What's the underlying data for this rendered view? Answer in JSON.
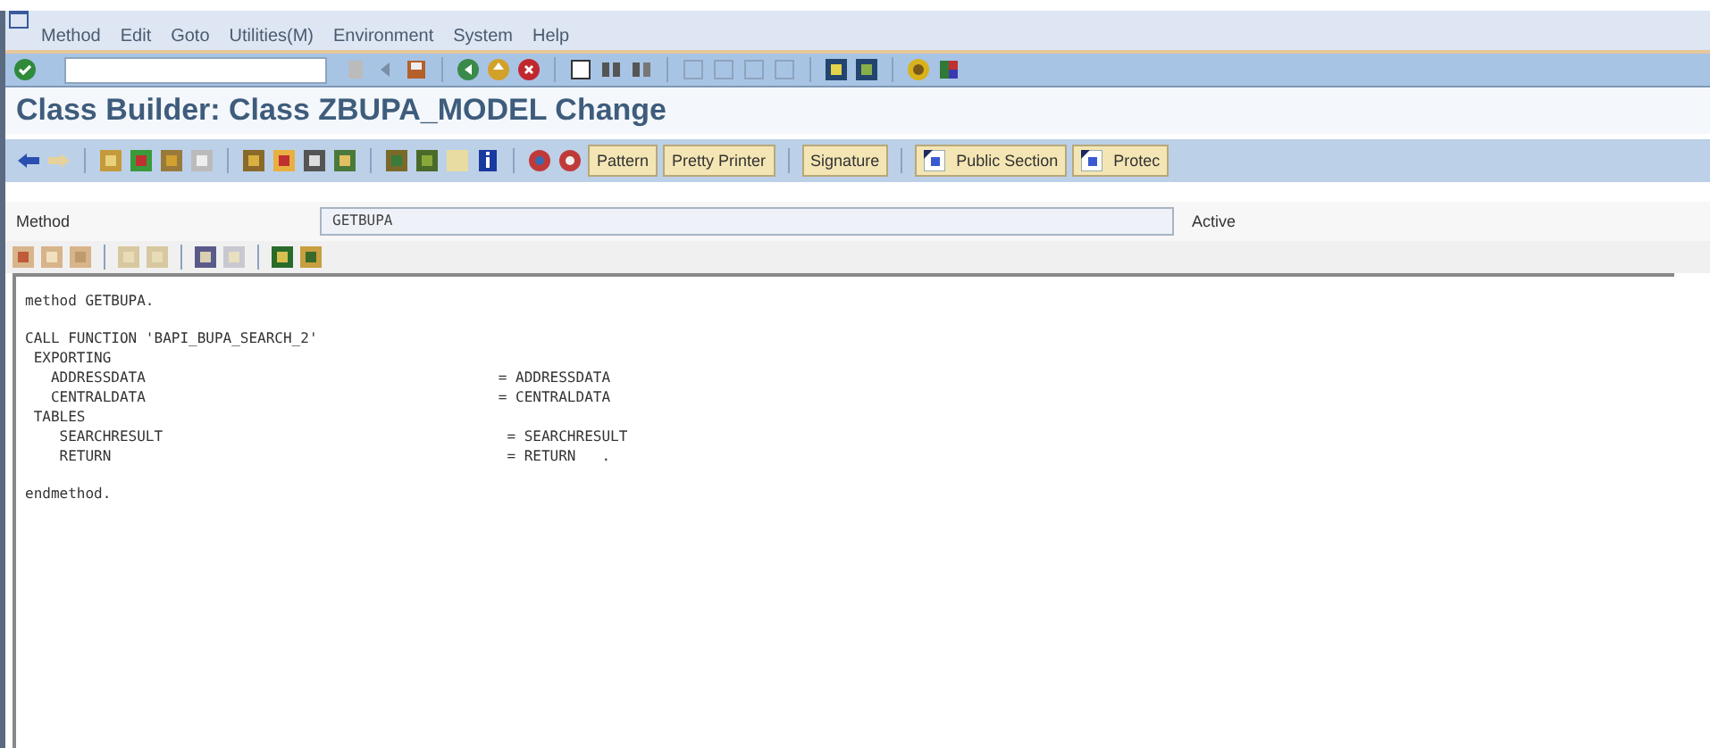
{
  "menu_bar": {
    "items": [
      "Method",
      "Edit",
      "Goto",
      "Utilities(M)",
      "Environment",
      "System",
      "Help"
    ]
  },
  "title": "Class Builder: Class ZBUPA_MODEL Change",
  "app_toolbar": {
    "buttons": [
      {
        "label": "Pattern",
        "kind": "text"
      },
      {
        "label": "Pretty Printer",
        "kind": "text"
      },
      {
        "label": "Signature",
        "kind": "text"
      },
      {
        "label": "Public Section",
        "kind": "icon_text"
      },
      {
        "label": "Protec",
        "kind": "icon_text"
      }
    ]
  },
  "method_row": {
    "label": "Method",
    "value": "GETBUPA",
    "status": "Active"
  },
  "editor": {
    "blocks": [
      [
        "method GETBUPA."
      ],
      [
        "CALL FUNCTION 'BAPI_BUPA_SEARCH_2'",
        " EXPORTING",
        "   ADDRESSDATA                                         = ADDRESSDATA",
        "   CENTRALDATA                                         = CENTRALDATA",
        " TABLES",
        "    SEARCHRESULT                                        = SEARCHRESULT",
        "    RETURN                                              = RETURN   ."
      ],
      [
        "endmethod."
      ]
    ]
  }
}
